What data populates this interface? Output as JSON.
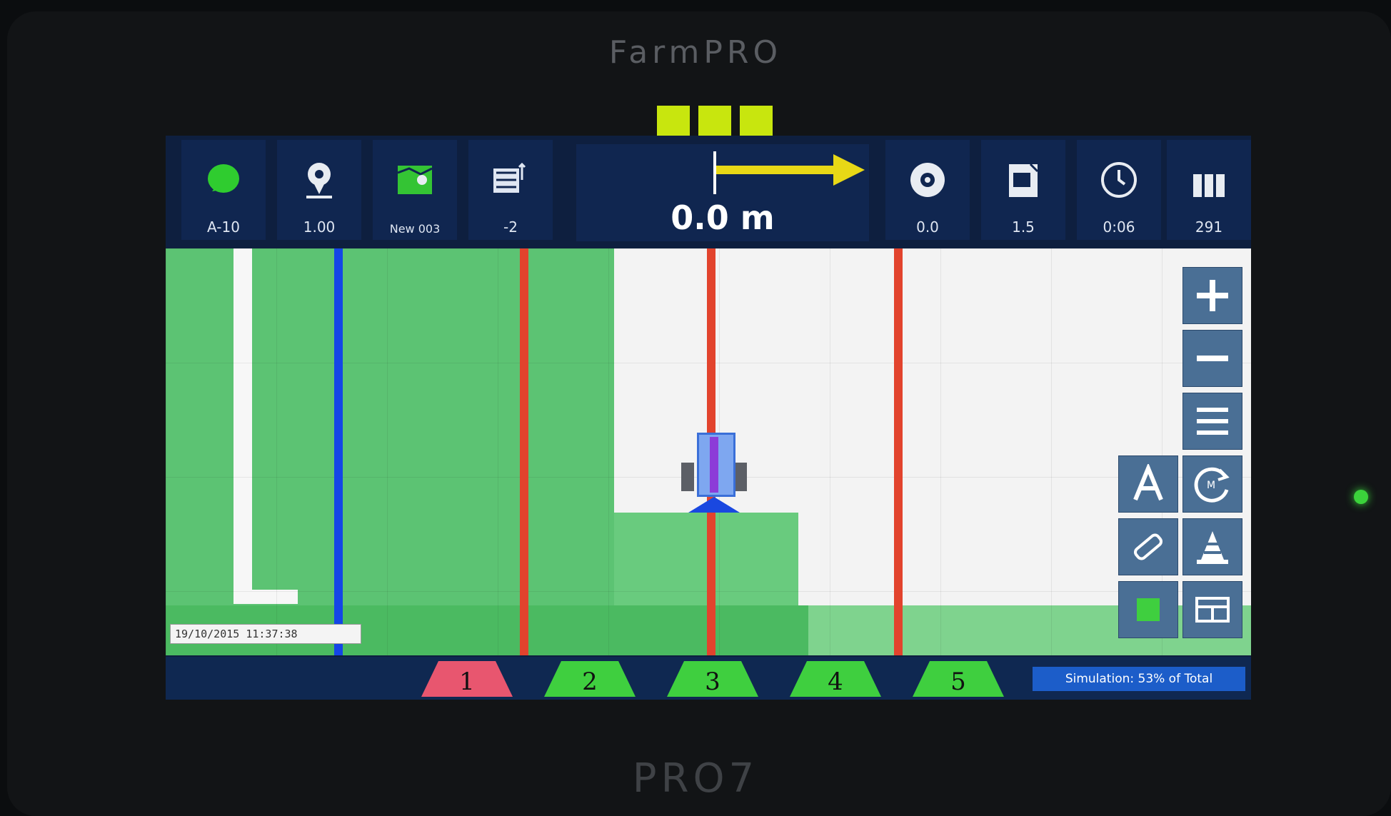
{
  "device": {
    "brand_top": "FarmPRO",
    "brand_bottom": "PRO7"
  },
  "topbar": {
    "tiles": [
      {
        "icon": "gps-signal-icon",
        "value": "A-10"
      },
      {
        "icon": "location-pin-icon",
        "value": "1.00"
      },
      {
        "icon": "field-map-icon",
        "value": "New 003"
      },
      {
        "icon": "swath-offset-icon",
        "value": "-2"
      },
      {
        "icon": "speed-wheel-icon",
        "value": "0.0"
      },
      {
        "icon": "area-icon",
        "value": "1.5"
      },
      {
        "icon": "clock-icon",
        "value": "0:06"
      },
      {
        "icon": "signal-bars-icon",
        "value": "291"
      }
    ],
    "lightbar": {
      "cross_track_error": "0.0 m",
      "direction": "right"
    }
  },
  "gps_indicator": {
    "count": 3,
    "color": "#c8e60e"
  },
  "map": {
    "timestamp": "19/10/2015 11:37:38",
    "colors": {
      "covered": "#5cc373",
      "uncovered": "#f3f3f3",
      "guidance_active": "#1446e6",
      "guidance_line": "#e2432d"
    }
  },
  "tools": [
    {
      "name": "zoom-in-button",
      "icon": "plus-icon"
    },
    {
      "name": "zoom-out-button",
      "icon": "minus-icon"
    },
    {
      "name": "menu-button",
      "icon": "menu-icon"
    },
    {
      "name": "auto-steer-button",
      "icon": "letter-a-icon"
    },
    {
      "name": "rotate-view-button",
      "icon": "rotate-icon"
    },
    {
      "name": "implement-button",
      "icon": "implement-icon"
    },
    {
      "name": "marker-button",
      "icon": "cone-icon"
    },
    {
      "name": "coverage-toggle-button",
      "icon": "green-square-icon"
    },
    {
      "name": "split-view-button",
      "icon": "split-view-icon"
    }
  ],
  "sections": {
    "items": [
      {
        "label": "1",
        "state": "off",
        "color": "#e8566f"
      },
      {
        "label": "2",
        "state": "on",
        "color": "#3fcf3f"
      },
      {
        "label": "3",
        "state": "on",
        "color": "#3fcf3f"
      },
      {
        "label": "4",
        "state": "on",
        "color": "#3fcf3f"
      },
      {
        "label": "5",
        "state": "on",
        "color": "#3fcf3f"
      }
    ],
    "status_text": "Simulation: 53% of Total"
  }
}
